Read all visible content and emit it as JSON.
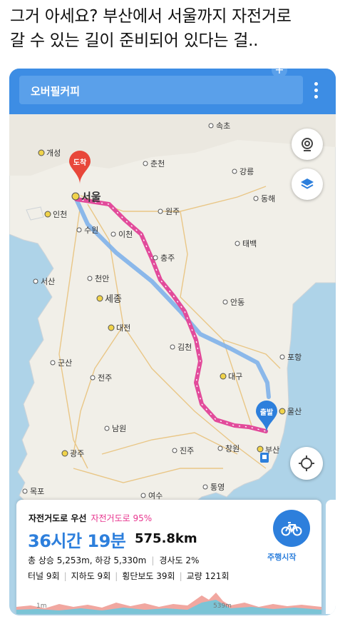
{
  "tweet": {
    "line1": "그거 아세요? 부산에서 서울까지 자전거로",
    "line2": "갈 수 있는 길이 준비되어 있다는 걸.."
  },
  "app": {
    "search_label": "오버필커피",
    "colors": {
      "header": "#3d8de4",
      "route_primary": "#e24b9b",
      "route_alt": "#7fb1ea",
      "accent": "#2d7fdc"
    }
  },
  "map": {
    "markers": {
      "arrival": "도착",
      "departure": "출발"
    },
    "places": [
      {
        "id": "sokcho",
        "label": "속초"
      },
      {
        "id": "gaeseong",
        "label": "개성"
      },
      {
        "id": "chuncheon",
        "label": "춘천"
      },
      {
        "id": "gangneung",
        "label": "강릉"
      },
      {
        "id": "seoul",
        "label": "서울"
      },
      {
        "id": "donghae",
        "label": "동해"
      },
      {
        "id": "incheon",
        "label": "인천"
      },
      {
        "id": "wonju",
        "label": "원주"
      },
      {
        "id": "suwon",
        "label": "수원"
      },
      {
        "id": "icheon",
        "label": "이천"
      },
      {
        "id": "taebaek",
        "label": "태백"
      },
      {
        "id": "chungju",
        "label": "충주"
      },
      {
        "id": "seosan",
        "label": "서산"
      },
      {
        "id": "cheonan",
        "label": "천안"
      },
      {
        "id": "sejong",
        "label": "세종"
      },
      {
        "id": "andong",
        "label": "안동"
      },
      {
        "id": "daejeon",
        "label": "대전"
      },
      {
        "id": "gimcheon",
        "label": "김천"
      },
      {
        "id": "pohang",
        "label": "포항"
      },
      {
        "id": "gunsan",
        "label": "군산"
      },
      {
        "id": "jeonju",
        "label": "전주"
      },
      {
        "id": "daegu",
        "label": "대구"
      },
      {
        "id": "ulsan",
        "label": "울산"
      },
      {
        "id": "namwon",
        "label": "남원"
      },
      {
        "id": "gwangju",
        "label": "광주"
      },
      {
        "id": "jinju",
        "label": "진주"
      },
      {
        "id": "changwon",
        "label": "창원"
      },
      {
        "id": "busan",
        "label": "부산"
      },
      {
        "id": "mokpo",
        "label": "목포"
      },
      {
        "id": "tongyeong",
        "label": "통영"
      },
      {
        "id": "yeosu",
        "label": "여수"
      }
    ]
  },
  "panel": {
    "mode": "자전거도로 우선",
    "bike_ratio": "자전거도로 95%",
    "duration": "36시간 19분",
    "distance": "575.8km",
    "elevation": "총 상승 5,253m, 하강 5,330m",
    "slope": "경사도 2%",
    "tunnel": "터널 9회",
    "underpass": "지하도 9회",
    "crosswalk": "횡단보도 39회",
    "bridge": "교량 121회",
    "start_label": "주행시작",
    "profile_start": "1m",
    "profile_mid": "539m"
  }
}
